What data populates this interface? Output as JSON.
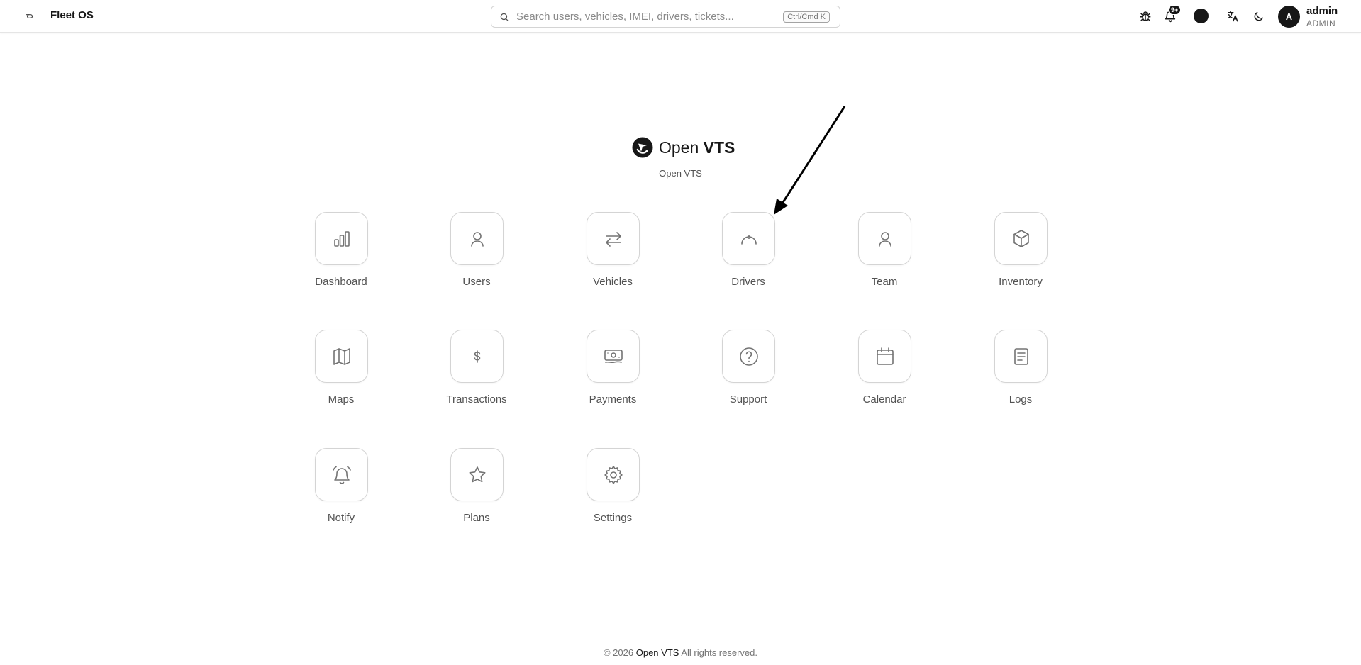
{
  "header": {
    "app_title": "Fleet OS",
    "search": {
      "placeholder": "Search users, vehicles, IMEI, drivers, tickets...",
      "shortcut": "Ctrl/Cmd K"
    },
    "notifications_badge": "9+",
    "user": {
      "name": "admin",
      "role": "ADMIN",
      "avatar_letter": "A"
    },
    "icons": [
      "sidebar-toggle-icon",
      "search-icon",
      "bug-icon",
      "bell-icon",
      "theme-color-icon",
      "translate-icon",
      "moon-icon"
    ]
  },
  "brand": {
    "name_prefix": "Open ",
    "name_bold": "VTS",
    "subtitle": "Open VTS"
  },
  "tiles": [
    {
      "label": "Dashboard",
      "icon": "bar-chart-icon"
    },
    {
      "label": "Users",
      "icon": "user-icon"
    },
    {
      "label": "Vehicles",
      "icon": "arrows-left-right-icon"
    },
    {
      "label": "Drivers",
      "icon": "steering-icon"
    },
    {
      "label": "Team",
      "icon": "team-icon"
    },
    {
      "label": "Inventory",
      "icon": "box-icon"
    },
    {
      "label": "Maps",
      "icon": "map-icon"
    },
    {
      "label": "Transactions",
      "icon": "dollar-icon"
    },
    {
      "label": "Payments",
      "icon": "banknote-icon"
    },
    {
      "label": "Support",
      "icon": "help-circle-icon"
    },
    {
      "label": "Calendar",
      "icon": "calendar-icon"
    },
    {
      "label": "Logs",
      "icon": "document-icon"
    },
    {
      "label": "Notify",
      "icon": "bell-ring-icon"
    },
    {
      "label": "Plans",
      "icon": "star-icon"
    },
    {
      "label": "Settings",
      "icon": "gear-icon"
    }
  ],
  "footer": {
    "copyright": "© 2026",
    "brand": "Open VTS",
    "rights": "All rights reserved."
  }
}
